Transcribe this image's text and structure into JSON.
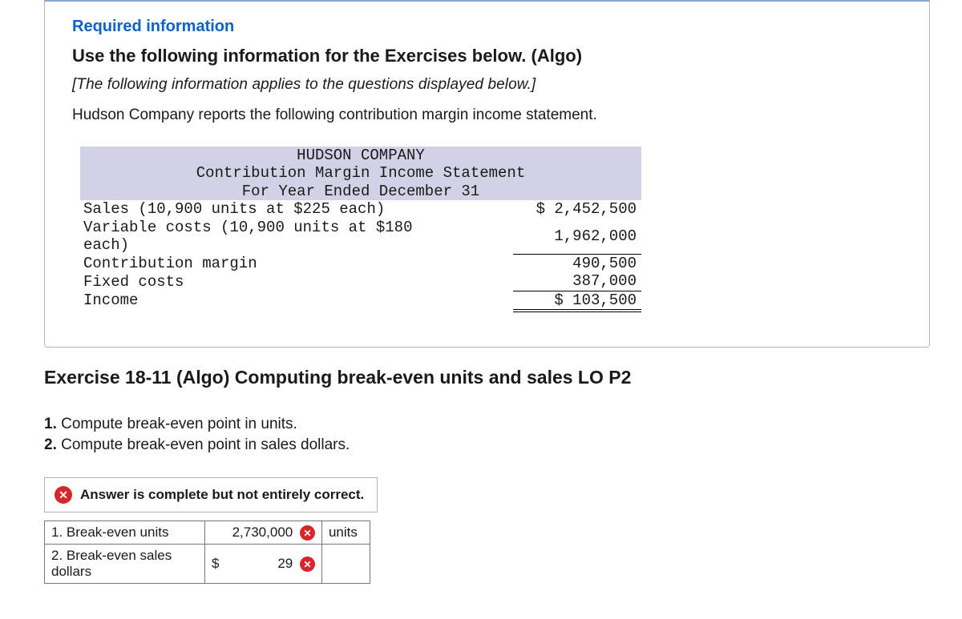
{
  "header": {
    "required_info_label": "Required information",
    "use_following": "Use the following information for the Exercises below. (Algo)",
    "applies_note": "[The following information applies to the questions displayed below.]",
    "intro_line": "Hudson Company reports the following contribution margin income statement."
  },
  "statement": {
    "company": "HUDSON COMPANY",
    "title": "Contribution Margin Income Statement",
    "period": "For Year Ended December 31",
    "rows": {
      "sales_label": "Sales (10,900 units at $225 each)",
      "sales_value": "$ 2,452,500",
      "varcost_label": "Variable costs (10,900 units at $180 each)",
      "varcost_value": "1,962,000",
      "cm_label": "Contribution margin",
      "cm_value": "490,500",
      "fixed_label": "Fixed costs",
      "fixed_value": "387,000",
      "income_label": "Income",
      "income_value": "$ 103,500"
    }
  },
  "exercise": {
    "title": "Exercise 18-11 (Algo) Computing break-even units and sales LO P2",
    "q1_num": "1.",
    "q1_text": " Compute break-even point in units.",
    "q2_num": "2.",
    "q2_text": " Compute break-even point in sales dollars."
  },
  "feedback": {
    "icon_glyph": "✕",
    "text": "Answer is complete but not entirely correct."
  },
  "answers": {
    "row1_label": "1. Break-even units",
    "row1_value": "2,730,000",
    "row1_units": "units",
    "row2_label": "2. Break-even sales dollars",
    "row2_dollar": "$",
    "row2_value": "29",
    "wrong_glyph": "✕"
  }
}
